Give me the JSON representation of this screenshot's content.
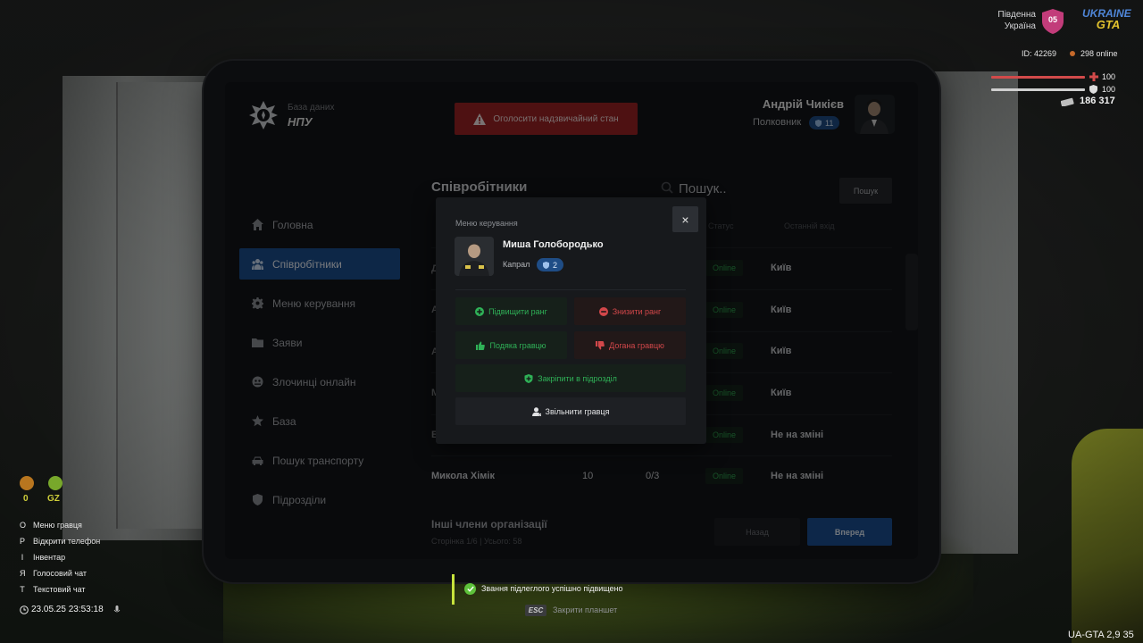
{
  "org": {
    "subtitle": "База даних",
    "title": "НПУ"
  },
  "emergency_button": "Оголосити надзвичайний стан",
  "user": {
    "name": "Андрій Чикієв",
    "rank": "Полковник",
    "rank_level": "11"
  },
  "sidebar": {
    "items": [
      {
        "label": "Головна",
        "icon": "home-icon"
      },
      {
        "label": "Співробітники",
        "icon": "users-icon",
        "active": true
      },
      {
        "label": "Меню керування",
        "icon": "gear-icon"
      },
      {
        "label": "Заяви",
        "icon": "folder-icon"
      },
      {
        "label": "Злочинці онлайн",
        "icon": "criminal-icon"
      },
      {
        "label": "База",
        "icon": "star-icon"
      },
      {
        "label": "Пошук транспорту",
        "icon": "car-icon"
      },
      {
        "label": "Підрозділи",
        "icon": "shield-icon"
      }
    ]
  },
  "employees": {
    "title": "Співробітники",
    "search_placeholder": "Пошук..",
    "search_button": "Пошук",
    "columns": {
      "status": "Статус",
      "last_login": "Останній вхід"
    },
    "rows": [
      {
        "name_fragment": "Д",
        "status": "Online",
        "city": "Київ"
      },
      {
        "name_fragment": "А",
        "status": "Online",
        "city": "Київ"
      },
      {
        "name_fragment": "А",
        "status": "Online",
        "city": "Київ"
      },
      {
        "name_fragment": "М",
        "status": "Online",
        "city": "Київ"
      },
      {
        "name_fragment": "Б",
        "status": "Online",
        "city": "Не на зміні"
      },
      {
        "name": "Микола Хімік",
        "rank": "10",
        "warnings": "0/3",
        "status": "Online",
        "city": "Не на зміні"
      }
    ],
    "other_members_title": "Інші члени організації",
    "page_info": "Сторінка 1/6 | Усього: 58",
    "back_button": "Назад",
    "next_button": "Вперед"
  },
  "modal": {
    "label": "Меню керування",
    "close": "×",
    "member": {
      "name": "Миша Голобородько",
      "rank": "Капрал",
      "rank_level": "2"
    },
    "actions": {
      "promote": "Підвищити ранг",
      "demote": "Знизити ранг",
      "thanks": "Подяка гравцю",
      "reprimand": "Догана гравцю",
      "assign": "Закріпити в підрозділ",
      "fire": "Звільнити гравця"
    }
  },
  "hud": {
    "region_line1": "Південна",
    "region_line2": "Україна",
    "server_badge": "05",
    "server_logo_line1": "UKRAINE",
    "server_logo_line2": "GTA",
    "player_id": "ID: 42269",
    "online": "298 online",
    "health": "100",
    "armor": "100",
    "money": "186 317",
    "hunger_value": "0",
    "gz_label": "GZ",
    "keys": [
      {
        "key": "O",
        "label": "Меню гравця"
      },
      {
        "key": "P",
        "label": "Відкрити телефон"
      },
      {
        "key": "I",
        "label": "Інвентар"
      },
      {
        "key": "Я",
        "label": "Голосовий чат"
      },
      {
        "key": "T",
        "label": "Текстовий чат"
      }
    ],
    "datetime": "23.05.25 23:53:18",
    "version": "UA-GTA 2,9   35"
  },
  "toast": {
    "text": "Звання підлеглого успішно підвищено"
  },
  "esc": {
    "key": "ESC",
    "hint": "Закрити планшет"
  },
  "colors": {
    "accent_blue": "#1a4f8f",
    "danger_red": "#9c2324",
    "success_green": "#2fb157",
    "online_green": "#2ea44f"
  }
}
